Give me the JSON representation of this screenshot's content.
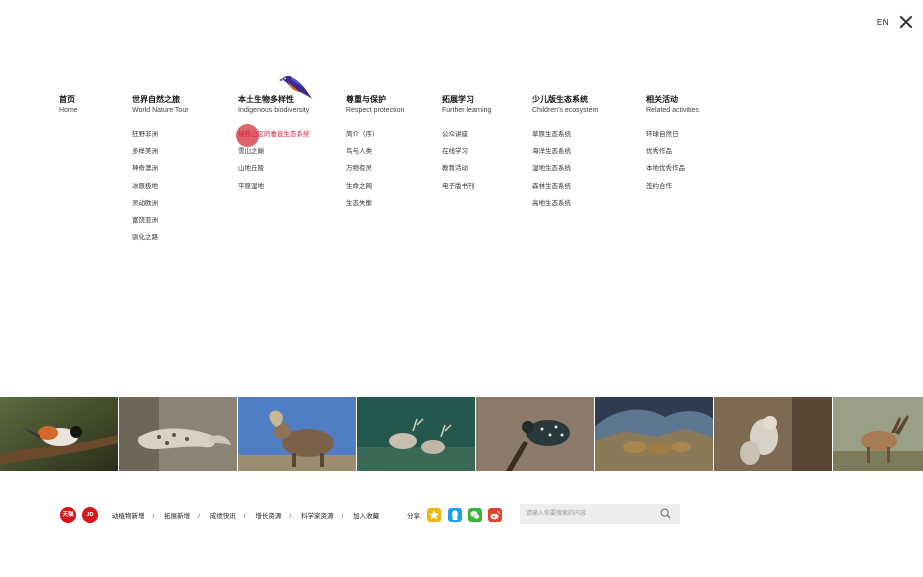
{
  "header": {
    "lang": "EN"
  },
  "nav": [
    {
      "title": "首页",
      "sub": "Home",
      "items": []
    },
    {
      "title": "世界自然之旅",
      "sub": "World Nature Tour",
      "items": [
        "狂野非洲",
        "多样美洲",
        "神奇澳洲",
        "冰原极地",
        "灵动欧洲",
        "富饶亚洲",
        "驯化之路"
      ]
    },
    {
      "title": "本土生物多样性",
      "sub": "Indigenous biodiversity",
      "items": [
        "横断山区的垂直生态系统",
        "雪山之巅",
        "山地丘陵",
        "平原湿地"
      ]
    },
    {
      "title": "尊重与保护",
      "sub": "Respect protection",
      "items": [
        "简介（序）",
        "鸟与人类",
        "万物有灵",
        "生命之网",
        "生态失衡"
      ]
    },
    {
      "title": "拓展学习",
      "sub": "Further learning",
      "items": [
        "公众讲座",
        "在线学习",
        "教育活动",
        "电子版书刊"
      ]
    },
    {
      "title": "少儿版生态系统",
      "sub": "Children's ecosystem",
      "items": [
        "草原生态系统",
        "海洋生态系统",
        "湿地生态系统",
        "森林生态系统",
        "高地生态系统"
      ]
    },
    {
      "title": "相关活动",
      "sub": "Related activities",
      "items": [
        "环球自然日",
        "优秀作品",
        "本地优秀作品",
        "签约合作"
      ]
    }
  ],
  "footer": {
    "shops": [
      "天猫",
      "JD"
    ],
    "links": [
      "动植物新增",
      "拓展新增",
      "成绩快讯",
      "增长资源",
      "科学家资源",
      "加入收藏"
    ],
    "share_label": "分享:",
    "search_placeholder": "请输入你要搜索的内容"
  },
  "colors": {
    "accent": "#d7263d",
    "qzone": "#f5b400",
    "qq": "#1ea0e6",
    "wechat": "#35b536",
    "weibo": "#e6432f"
  }
}
